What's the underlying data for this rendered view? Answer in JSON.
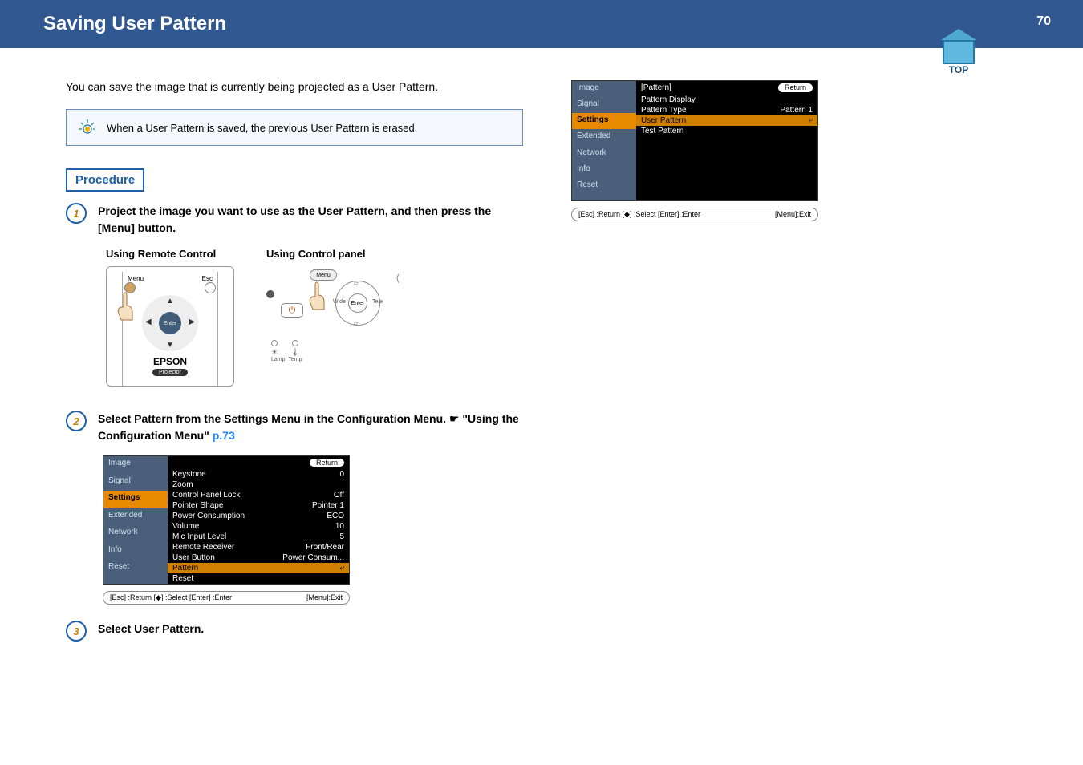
{
  "page": {
    "title": "Saving User Pattern",
    "number": "70",
    "top_label": "TOP"
  },
  "intro": "You can save the image that is currently being projected as a User Pattern.",
  "note": "When a User Pattern is saved, the previous User Pattern is erased.",
  "procedure_label": "Procedure",
  "steps": {
    "s1": {
      "num": "1",
      "text": "Project the image you want to use as the User Pattern, and then press the [Menu] button."
    },
    "s2": {
      "num": "2",
      "text_a": "Select Pattern from the Settings Menu in the Configuration Menu. ",
      "text_b": "\"Using the Configuration Menu\" ",
      "link": "p.73"
    },
    "s3": {
      "num": "3",
      "text": "Select User Pattern."
    }
  },
  "diagram_titles": {
    "remote": "Using Remote Control",
    "panel": "Using Control panel"
  },
  "remote": {
    "menu": "Menu",
    "esc": "Esc",
    "enter": "Enter",
    "brand": "EPSON",
    "projector": "Projector"
  },
  "panel": {
    "menu": "Menu",
    "wide": "Wide",
    "tele": "Tele",
    "enter": "Enter",
    "lamp": "Lamp",
    "temp": "Temp"
  },
  "osd_sidebar": [
    "Image",
    "Signal",
    "Settings",
    "Extended",
    "Network",
    "Info",
    "Reset"
  ],
  "osd1": {
    "rows": [
      {
        "label": "Keystone",
        "val": "0"
      },
      {
        "label": "Zoom",
        "val": ""
      },
      {
        "label": "Control Panel Lock",
        "val": "Off"
      },
      {
        "label": "Pointer Shape",
        "val": "Pointer 1"
      },
      {
        "label": "Power Consumption",
        "val": "ECO"
      },
      {
        "label": "Volume",
        "val": "10"
      },
      {
        "label": "Mic Input Level",
        "val": "5"
      },
      {
        "label": "Remote Receiver",
        "val": "Front/Rear"
      },
      {
        "label": "User Button",
        "val": "Power Consum..."
      },
      {
        "label": "Pattern",
        "val": "",
        "hl": true
      },
      {
        "label": "Reset",
        "val": ""
      }
    ],
    "return": "Return"
  },
  "osd2": {
    "header": "[Pattern]",
    "return": "Return",
    "rows": [
      {
        "label": "Pattern Display",
        "val": ""
      },
      {
        "label": "Pattern Type",
        "val": "Pattern 1"
      },
      {
        "label": "User Pattern",
        "val": "",
        "hl": true
      },
      {
        "label": "Test Pattern",
        "val": ""
      }
    ]
  },
  "osd_footer": {
    "left": "[Esc] :Return  [◆] :Select  [Enter] :Enter",
    "right": "[Menu]:Exit"
  }
}
